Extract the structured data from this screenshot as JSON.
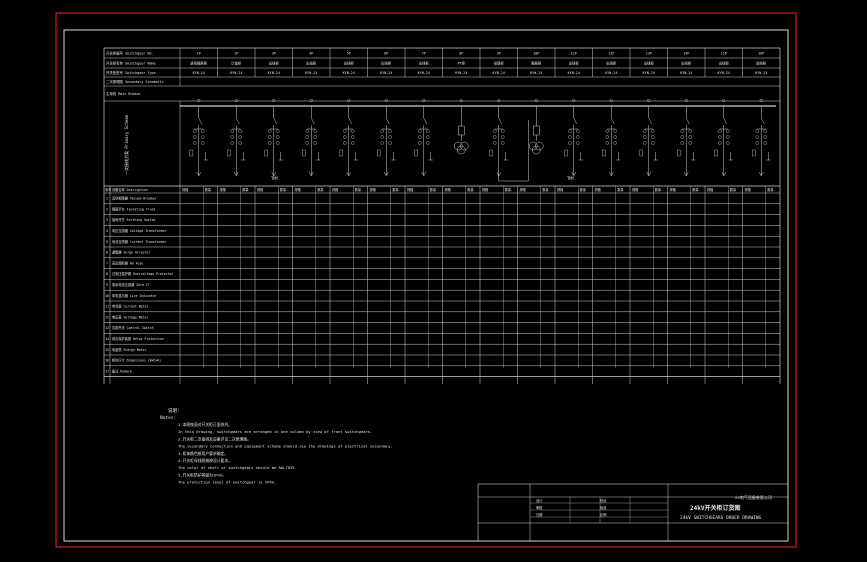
{
  "colors": {
    "background": "#2d3340",
    "sheet": "#000000",
    "outer_frame": "#c81e1e",
    "inner_frame": "#dcdcdc",
    "lines": "#cfcfcf",
    "text": "#e6e6e6"
  },
  "header_rows": [
    {
      "label": "开关柜编号 Switchgear No.",
      "cells": [
        "1P",
        "2P",
        "3P",
        "4P",
        "5P",
        "6P",
        "7P",
        "8P",
        "9P",
        "10P",
        "11P",
        "12P",
        "13P",
        "14P",
        "15P",
        "16P"
      ]
    },
    {
      "label": "开关柜名称 Switchgear Name",
      "cells": [
        "进线隔离柜",
        "计量柜",
        "出线柜",
        "出线柜",
        "出线柜",
        "出线柜",
        "出线柜",
        "PT柜",
        "母联柜",
        "隔离柜",
        "出线柜",
        "出线柜",
        "出线柜",
        "出线柜",
        "出线柜",
        "进线柜"
      ]
    },
    {
      "label": "开关柜型号 Switchgear Type",
      "cells": [
        "KYN-24",
        "KYN-24",
        "KYN-24",
        "KYN-24",
        "KYN-24",
        "KYN-24",
        "KYN-24",
        "KYN-24",
        "KYN-24",
        "KYN-24",
        "KYN-24",
        "KYN-24",
        "KYN-24",
        "KYN-24",
        "KYN-24",
        "KYN-24"
      ]
    },
    {
      "label": "二次原理图 Secondary Schematic",
      "cells": []
    },
    {
      "label": "主母线 Main Busbar",
      "cells": []
    }
  ],
  "schematic_label": "一次接线方案 Primary Scheme",
  "schematic_notes": [
    "TMY",
    "TMY"
  ],
  "equipment_header": {
    "no": "序号",
    "name": "设备名称 Description",
    "col_a": "规格",
    "col_b": "数量"
  },
  "equipment_rows": [
    {
      "no": "1",
      "name": "真空断路器 Vacuum Breaker"
    },
    {
      "no": "2",
      "name": "隔离手车 Isolating Truck"
    },
    {
      "no": "3",
      "name": "接地开关 Earthing Switch"
    },
    {
      "no": "4",
      "name": "电压互感器 Voltage Transformer"
    },
    {
      "no": "5",
      "name": "电流互感器 Current Transformer"
    },
    {
      "no": "6",
      "name": "避雷器 Surge Arrester"
    },
    {
      "no": "7",
      "name": "高压熔断器 HV Fuse"
    },
    {
      "no": "8",
      "name": "过电压保护器 Overvoltage Protector"
    },
    {
      "no": "9",
      "name": "零序电流互感器 Zero CT"
    },
    {
      "no": "10",
      "name": "带电显示器 Live Indicator"
    },
    {
      "no": "11",
      "name": "电流表 Current Meter"
    },
    {
      "no": "12",
      "name": "电压表 Voltage Meter"
    },
    {
      "no": "13",
      "name": "控制开关 Control Switch"
    },
    {
      "no": "14",
      "name": "综合保护装置 Relay Protection"
    },
    {
      "no": "15",
      "name": "电度表 Energy Meter"
    },
    {
      "no": "16",
      "name": "柜体尺寸 Dimensions (W×D×H)"
    },
    {
      "no": "17",
      "name": "备注 Remark"
    }
  ],
  "notes": {
    "title": "说明:",
    "subtitle": "Notes:",
    "lines": [
      "1.本图按面对开关柜正面排列。",
      "In this drawing, switchgears are arranged in one column by view of front switchgears.",
      "2.开关柜二次接线及设备详见二次原理图。",
      "The secondary connection and equipment scheme should see the drawings of electrical secondary.",
      "3.柜体颜色按用户要求确定。",
      "4.开关柜母线规格按设计要求。",
      "The color of shell of switchgears should be RAL7035.",
      "5.开关柜防护等级为IP4X。",
      "The protection level of switchgear is IP4X."
    ]
  },
  "title_block": {
    "company": "××电气设备有限公司",
    "title_cn": "24kV开关柜订货图",
    "title_en": "24kV SWITCHGEARS ORDER DRAWING",
    "labels": [
      "设计",
      "校对",
      "审核",
      "批准",
      "日期",
      "比例"
    ]
  }
}
